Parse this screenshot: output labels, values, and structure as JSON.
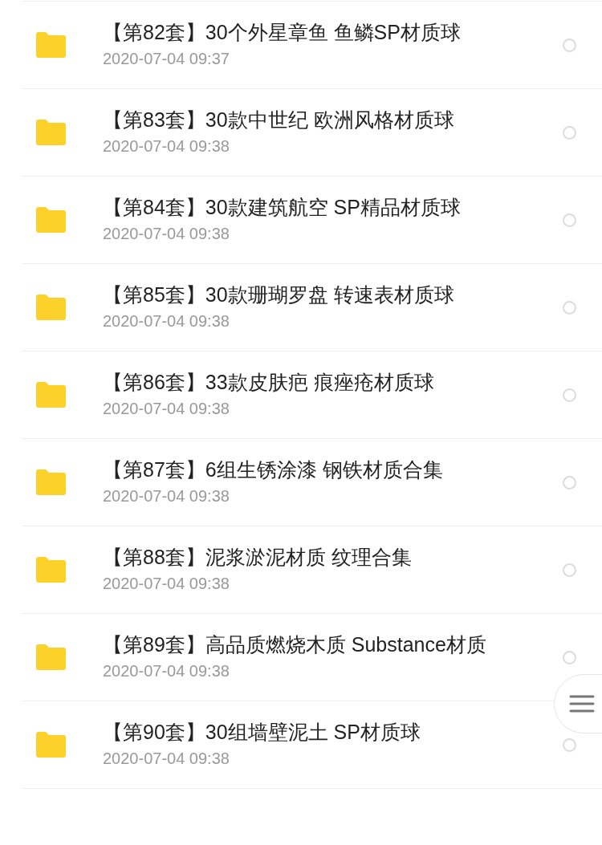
{
  "files": [
    {
      "name": "【第82套】30个外星章鱼 鱼鳞SP材质球",
      "date": "2020-07-04 09:37",
      "selected": false
    },
    {
      "name": "【第83套】30款中世纪 欧洲风格材质球",
      "date": "2020-07-04 09:38",
      "selected": false
    },
    {
      "name": "【第84套】30款建筑航空 SP精品材质球",
      "date": "2020-07-04 09:38",
      "selected": false
    },
    {
      "name": "【第85套】30款珊瑚罗盘 转速表材质球",
      "date": "2020-07-04 09:38",
      "selected": false
    },
    {
      "name": "【第86套】33款皮肤疤 痕痤疮材质球",
      "date": "2020-07-04 09:38",
      "selected": false
    },
    {
      "name": "【第87套】6组生锈涂漆 钢铁材质合集",
      "date": "2020-07-04 09:38",
      "selected": false
    },
    {
      "name": "【第88套】泥浆淤泥材质 纹理合集",
      "date": "2020-07-04 09:38",
      "selected": false
    },
    {
      "name": "【第89套】高品质燃烧木质 Substance材质",
      "date": "2020-07-04 09:38",
      "selected": false
    },
    {
      "name": "【第90套】30组墙壁泥土 SP材质球",
      "date": "2020-07-04 09:38",
      "selected": false
    }
  ]
}
